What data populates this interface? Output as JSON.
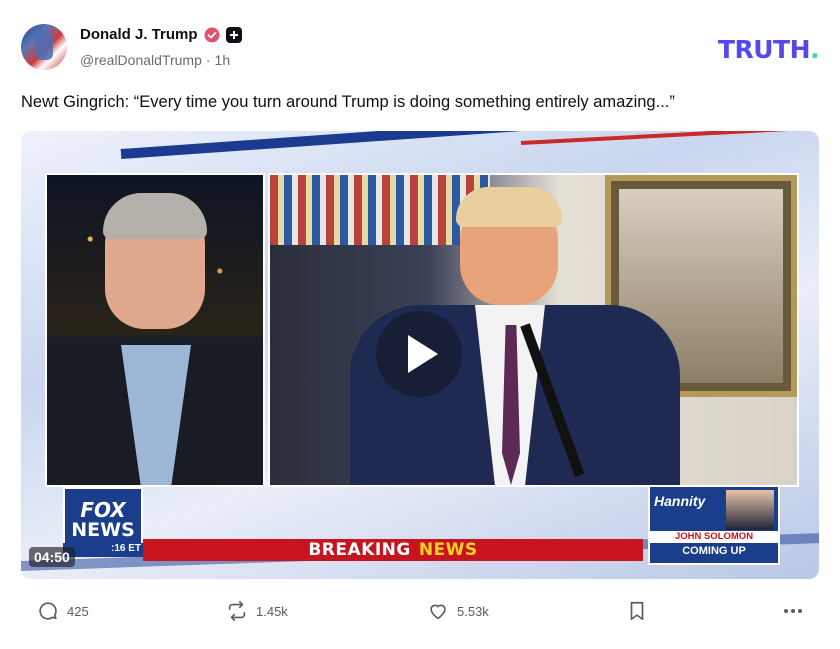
{
  "post": {
    "author_name": "Donald J. Trump",
    "handle": "@realDonaldTrump",
    "separator": "·",
    "time_ago": "1h",
    "text": "Newt Gingrich: “Every time you turn around Trump is doing something entirely amazing...”"
  },
  "brand": {
    "logo_main": "TRUTH",
    "logo_dot": ".",
    "logo_color": "#5448ee",
    "dot_color": "#4ed0c8"
  },
  "video": {
    "duration": "04:50",
    "network_line1": "FOX",
    "network_line2": "NEWS",
    "network_time": ":16 ET",
    "ticker_white": "BREAKING",
    "ticker_yellow": "NEWS",
    "promo_show": "Hannity",
    "promo_guest": "JOHN SOLOMON",
    "promo_status": "COMING UP"
  },
  "actions": {
    "replies": "425",
    "reposts": "1.45k",
    "likes": "5.53k"
  },
  "icons": {
    "verified": "verified-badge-icon",
    "plus": "plus-badge-icon",
    "reply": "reply-icon",
    "repost": "repost-icon",
    "like": "heart-icon",
    "bookmark": "bookmark-icon",
    "more": "more-icon",
    "play": "play-icon"
  },
  "colors": {
    "verified": "#e0526d",
    "breaking_red": "#c8141e",
    "fox_blue": "#1b3e8c"
  }
}
